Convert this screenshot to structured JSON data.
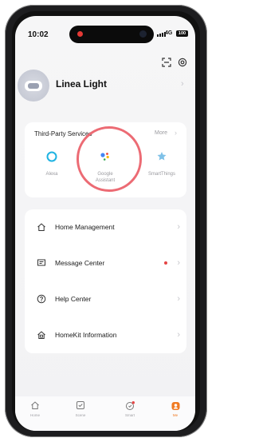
{
  "status_bar": {
    "time": "10:02",
    "network": "4G",
    "battery": "100"
  },
  "header": {
    "scan_icon": "scan-icon",
    "settings_icon": "settings-icon"
  },
  "profile": {
    "name": "Linea Light",
    "avatar_icon": "lamp-device-icon"
  },
  "third_party_services": {
    "title": "Third-Party Services",
    "more_label": "More",
    "services": [
      {
        "label": "Alexa",
        "icon": "alexa-icon"
      },
      {
        "label": "Google Assistant",
        "icon": "google-assistant-icon"
      },
      {
        "label": "SmartThings",
        "icon": "smartthings-icon"
      }
    ]
  },
  "menu": {
    "items": [
      {
        "label": "Home Management",
        "icon": "home-icon"
      },
      {
        "label": "Message Center",
        "icon": "message-icon",
        "has_notification": true
      },
      {
        "label": "Help Center",
        "icon": "help-icon"
      },
      {
        "label": "HomeKit Information",
        "icon": "homekit-icon"
      }
    ]
  },
  "tabbar": {
    "tabs": [
      {
        "label": "Home",
        "icon": "home-tab-icon"
      },
      {
        "label": "Scene",
        "icon": "scene-tab-icon"
      },
      {
        "label": "Smart",
        "icon": "smart-tab-icon"
      },
      {
        "label": "Me",
        "icon": "me-tab-icon",
        "active": true
      }
    ]
  },
  "colors": {
    "accent": "#f07a22",
    "highlight_ring": "#ec6b74",
    "notification_dot": "#e54545"
  }
}
